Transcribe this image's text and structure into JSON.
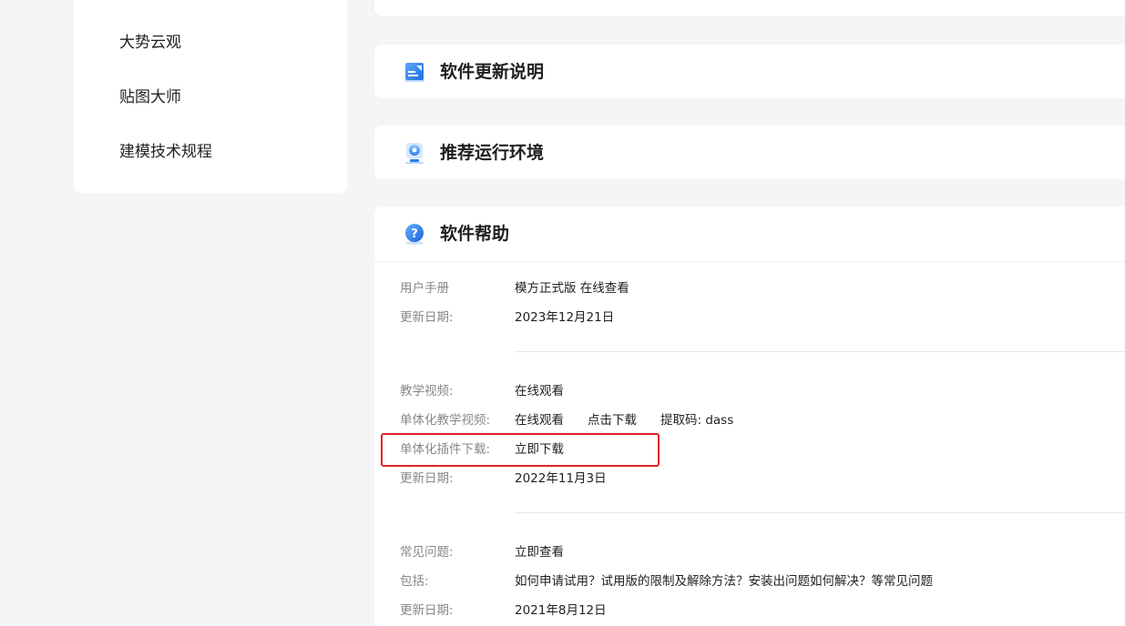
{
  "sidebar": {
    "items": [
      {
        "label": "大势云观"
      },
      {
        "label": "贴图大师"
      },
      {
        "label": "建模技术规程"
      }
    ]
  },
  "cards": {
    "update_notes": {
      "title": "软件更新说明",
      "icon": "document-arrow-icon"
    },
    "environment": {
      "title": "推荐运行环境",
      "icon": "computer-monitor-icon"
    },
    "help": {
      "title": "软件帮助",
      "icon": "question-mark-icon"
    }
  },
  "help": {
    "manual": {
      "label": "用户手册",
      "value": "模方正式版 在线查看",
      "date_label": "更新日期:",
      "date": "2023年12月21日"
    },
    "videos": {
      "tutorial_label": "教学视频:",
      "tutorial_link": "在线观看",
      "mono_label": "单体化教学视频:",
      "mono_watch": "在线观看",
      "mono_download": "点击下载",
      "extract_code": "提取码: dass",
      "plugin_label": "单体化插件下载:",
      "plugin_link": "立即下载",
      "date_label": "更新日期:",
      "date": "2022年11月3日"
    },
    "faq": {
      "label": "常见问题:",
      "link": "立即查看",
      "includes_label": "包括:",
      "includes": "如何申请试用？试用版的限制及解除方法？安装出问题如何解决？等常见问题",
      "date_label": "更新日期:",
      "date": "2021年8月12日"
    }
  },
  "colors": {
    "accent": "#2f7de1",
    "highlight": "#e0232b"
  }
}
